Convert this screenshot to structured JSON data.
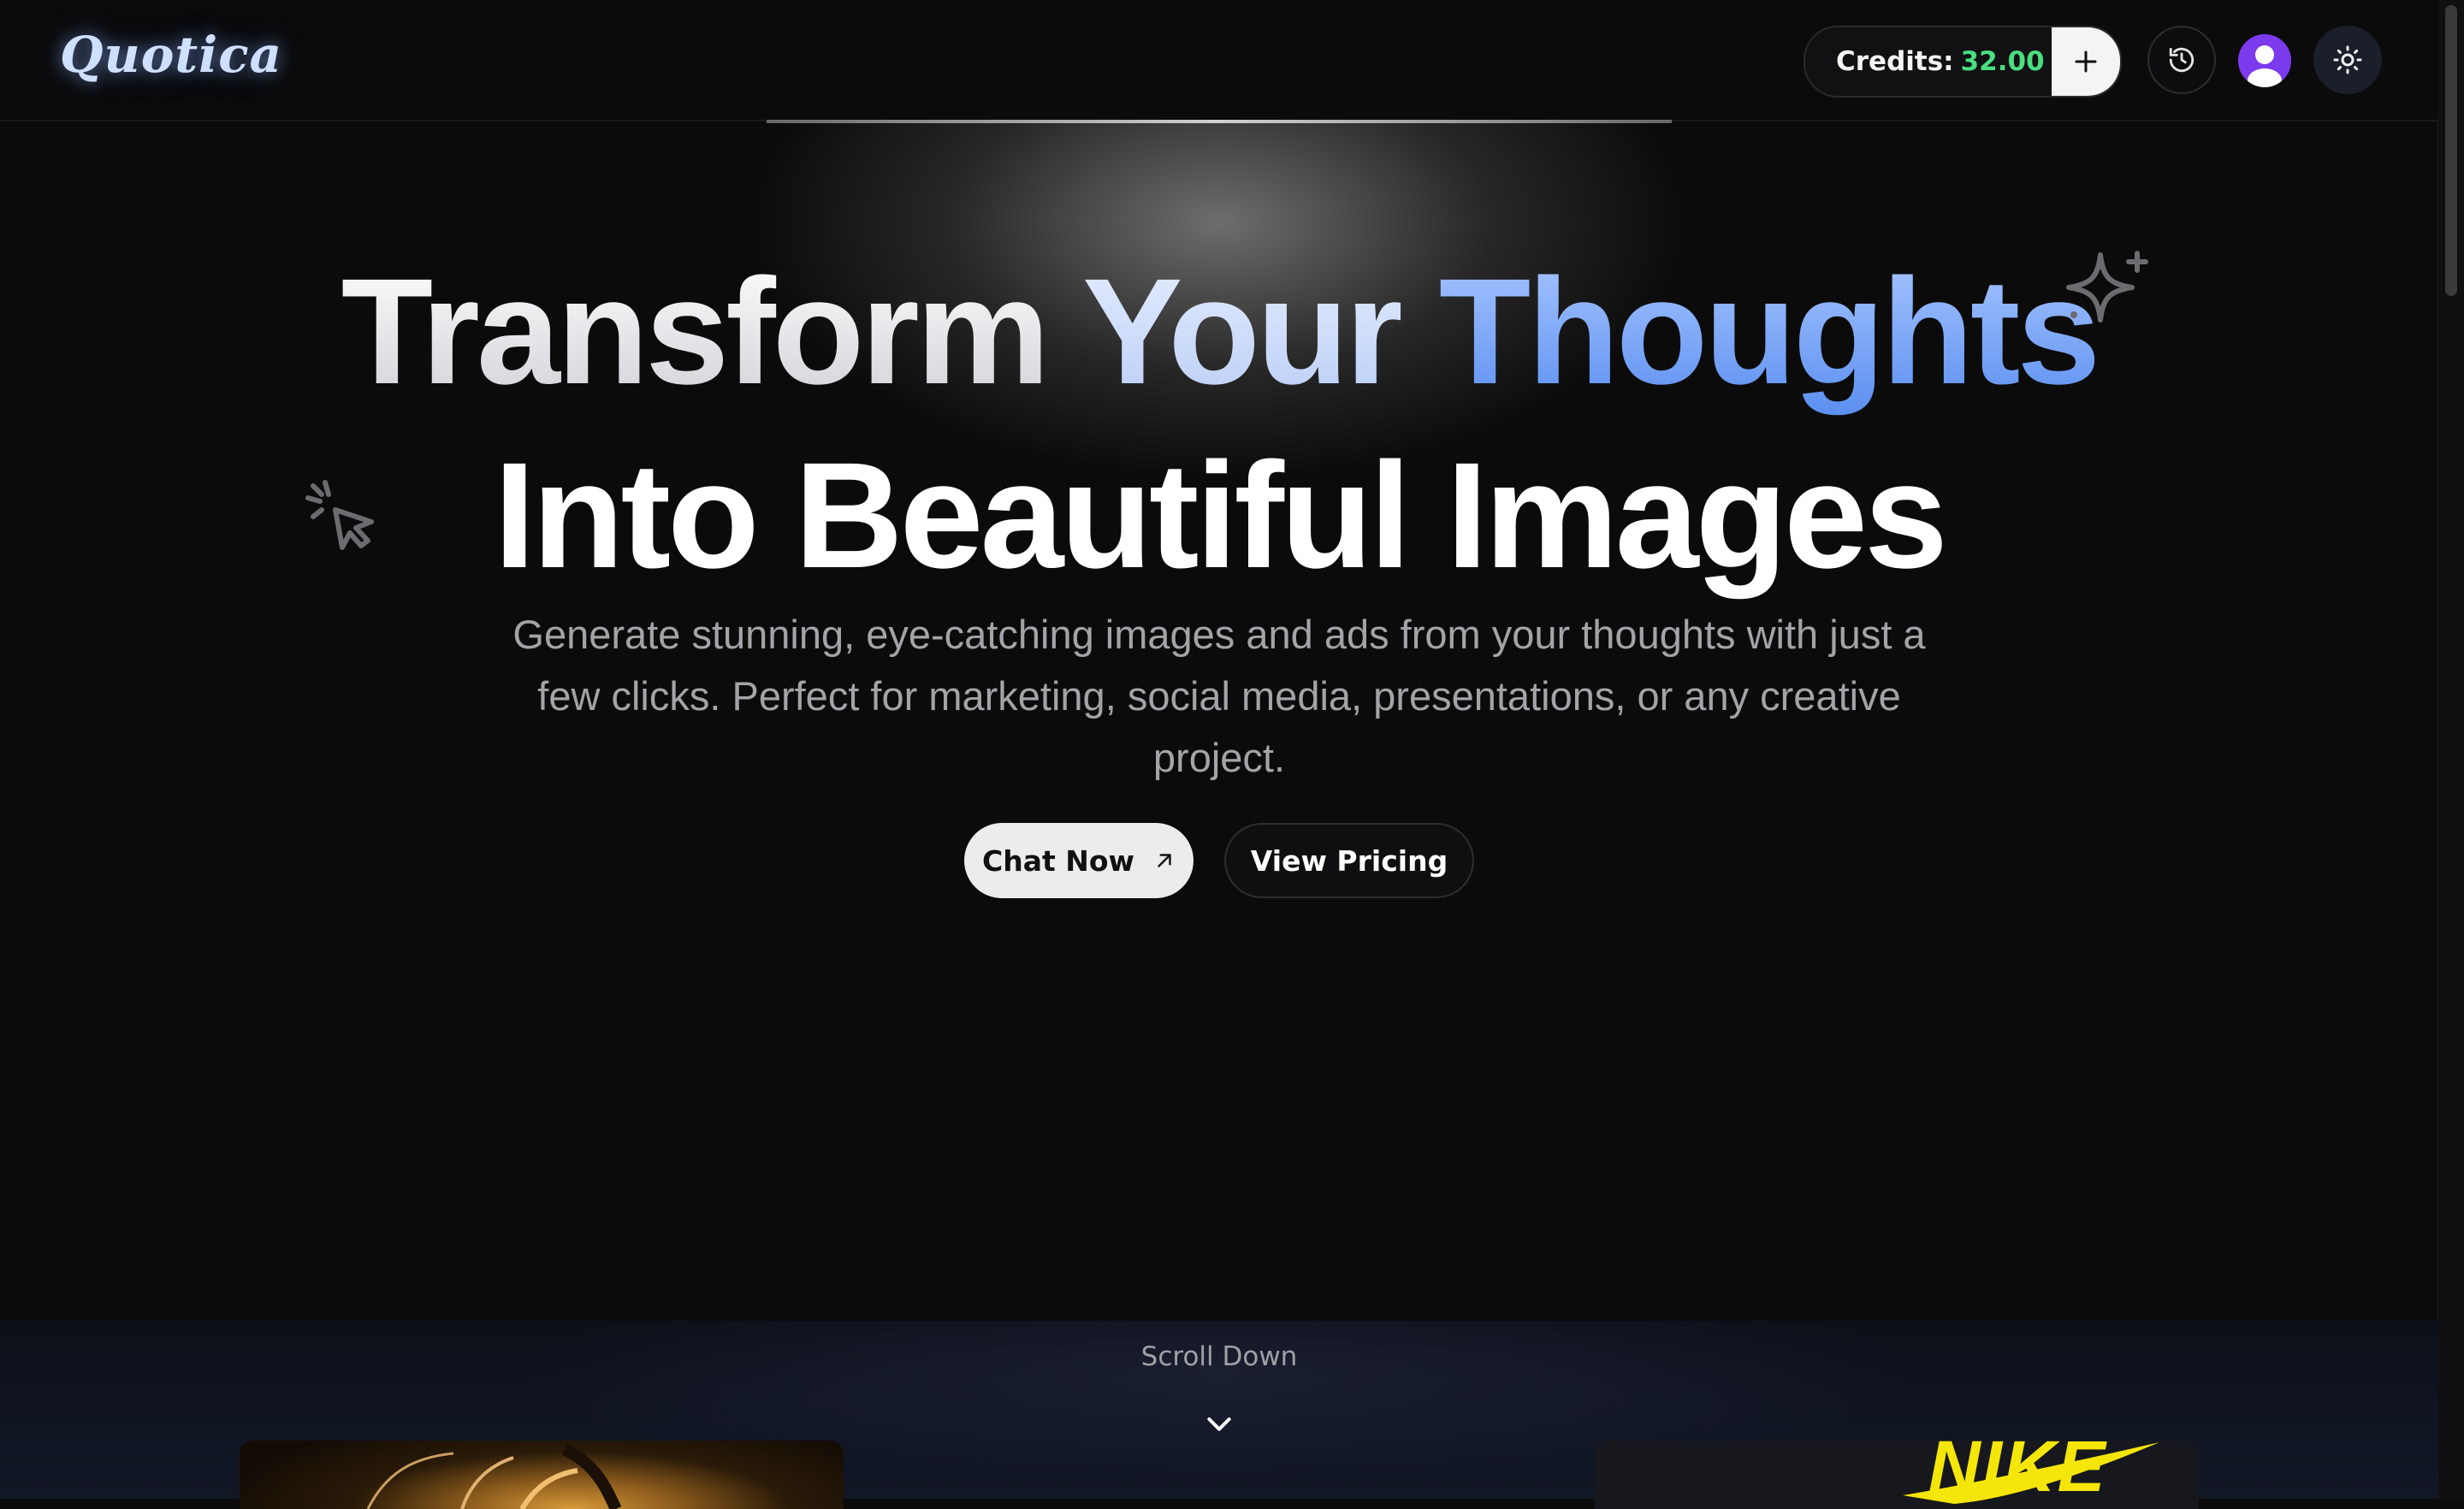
{
  "header": {
    "logo_text": "Quotica",
    "credits_label": "Credits:",
    "credits_value": "32.00",
    "icons": {
      "add": "plus-icon",
      "history": "history-icon",
      "avatar": "user-avatar-icon",
      "theme": "sun-icon"
    }
  },
  "hero": {
    "title_line1_word1": "Transform",
    "title_line1_word2": "Your",
    "title_line1_word3": "Thoughts",
    "title_line2": "Into Beautiful Images",
    "subtitle": "Generate stunning, eye-catching images and ads from your thoughts with just a few clicks. Perfect for marketing, social media, presentations, or any creative project.",
    "primary_cta": "Chat Now",
    "secondary_cta": "View Pricing",
    "decorations": [
      "sparkle-icon",
      "cursor-click-icon"
    ]
  },
  "showcase": {
    "scroll_label": "Scroll Down",
    "right_card_brand": "NIKE"
  },
  "colors": {
    "background": "#0b0b0c",
    "credits_value": "#4ade80",
    "accent_blue": "#5b8ff0",
    "avatar": "#7c3aed"
  }
}
